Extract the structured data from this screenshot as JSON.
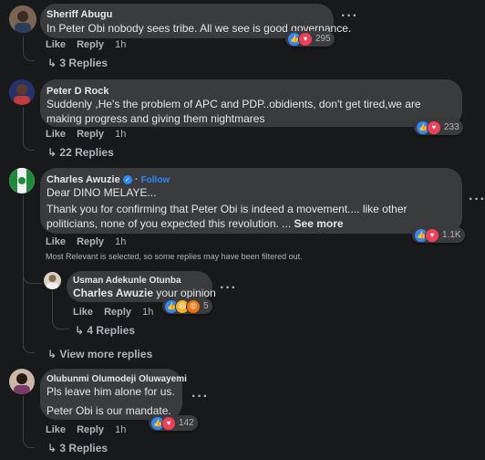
{
  "comments": [
    {
      "author": "Sheriff Abugu",
      "text": "In Peter Obi nobody sees tribe. All we see is good governance.",
      "reaction_count": "295",
      "like": "Like",
      "reply": "Reply",
      "time": "1h",
      "replies": "3 Replies"
    },
    {
      "author": "Peter D Rock",
      "text": "Suddenly ,He's the problem of APC and PDP..obidients, don't get tired,we are making progress and giving them nightmares",
      "reaction_count": "233",
      "like": "Like",
      "reply": "Reply",
      "time": "1h",
      "replies": "22 Replies"
    },
    {
      "author": "Charles Awuzie",
      "follow": "Follow",
      "line1": "Dear DINO MELAYE...",
      "line2": "Thank you for confirming that Peter Obi is indeed a movement.... like other politicians, none of you expected this revolution. ...",
      "see_more": "See more",
      "reaction_count": "1.1K",
      "like": "Like",
      "reply": "Reply",
      "time": "1h",
      "filter_note": "Most Relevant is selected, so some replies may have been filtered out.",
      "nested_reply": {
        "author": "Usman Adekunle Otunba",
        "mention": "Charles Awuzie",
        "text": "your opinion",
        "reaction_count": "5",
        "like": "Like",
        "reply": "Reply",
        "time": "1h",
        "replies": "4 Replies"
      },
      "view_more": "View more replies"
    },
    {
      "author": "Olubunmi Olumodeji Oluwayemi",
      "line1": "Pls leave him alone for us.",
      "line2": "Peter Obi is our mandate.",
      "reaction_count": "142",
      "like": "Like",
      "reply": "Reply",
      "time": "1h",
      "replies": "3 Replies"
    }
  ],
  "icons": {
    "like_reaction": "like-icon",
    "love_reaction": "love-icon",
    "haha_reaction": "haha-icon",
    "angry_reaction": "angry-icon",
    "more": "more-options-icon",
    "reply_arrow": "reply-arrow-icon"
  },
  "colors": {
    "background": "#18191a",
    "bubble": "#3a3b3c",
    "link": "#2d88ff",
    "like": "#2d88ff",
    "love": "#f33e58"
  }
}
